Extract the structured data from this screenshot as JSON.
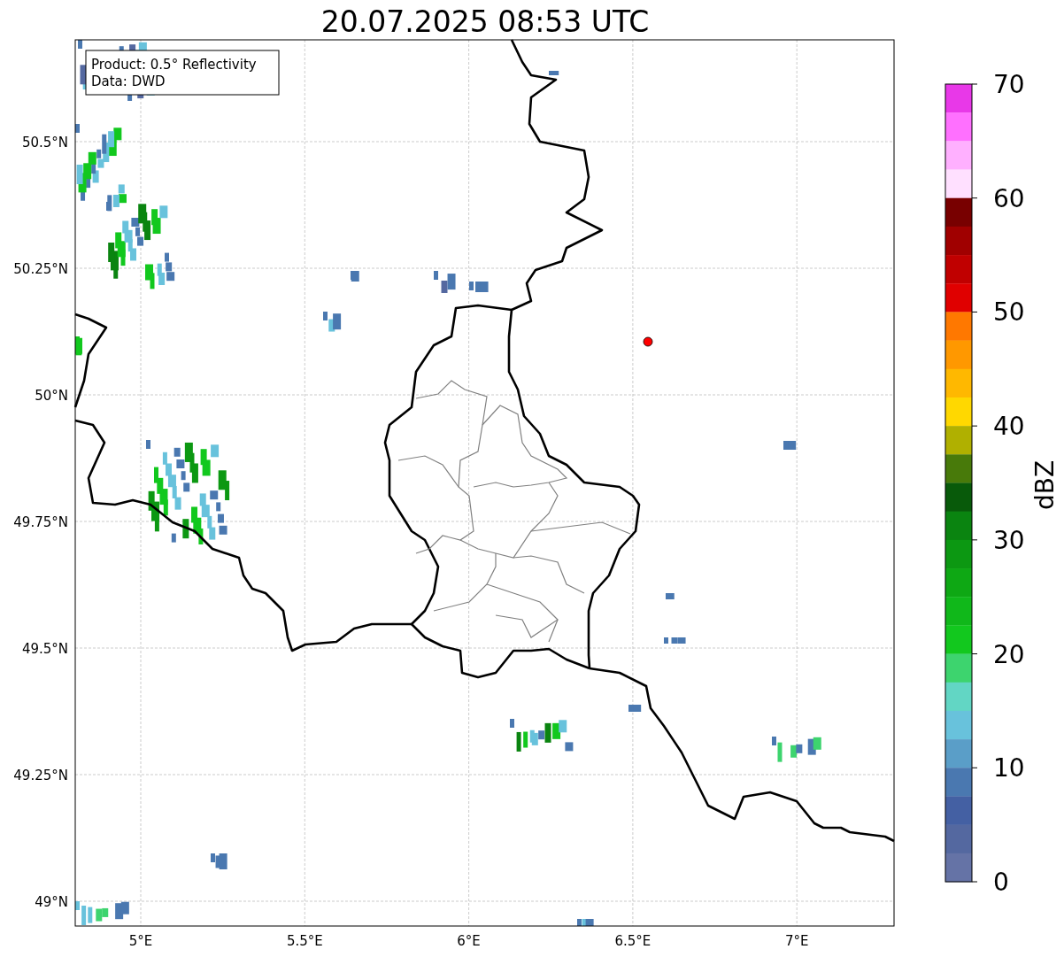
{
  "title": "20.07.2025 08:53 UTC",
  "info_box": [
    "Product: 0.5° Reflectivity",
    "Data: DWD"
  ],
  "lat_ticks": [
    "50.5°N",
    "50.25°N",
    "50°N",
    "49.75°N",
    "49.5°N",
    "49.25°N",
    "49°N"
  ],
  "lon_ticks": [
    "5°E",
    "5.5°E",
    "6°E",
    "6.5°E",
    "7°E"
  ],
  "colorbar": {
    "label": "dBZ",
    "ticks": [
      "70",
      "60",
      "50",
      "40",
      "30",
      "20",
      "10",
      "0"
    ],
    "bands": [
      {
        "color": "#e838e8"
      },
      {
        "color": "#ff70ff"
      },
      {
        "color": "#ffb0ff"
      },
      {
        "color": "#ffe0ff"
      },
      {
        "color": "#780000"
      },
      {
        "color": "#a00000"
      },
      {
        "color": "#c00000"
      },
      {
        "color": "#e00000"
      },
      {
        "color": "#ff7800"
      },
      {
        "color": "#ff9800"
      },
      {
        "color": "#ffb800"
      },
      {
        "color": "#ffd800"
      },
      {
        "color": "#b0b000"
      },
      {
        "color": "#487a0a"
      },
      {
        "color": "#085a0a"
      },
      {
        "color": "#0a8410"
      },
      {
        "color": "#0c9812"
      },
      {
        "color": "#0ea814"
      },
      {
        "color": "#10b81a"
      },
      {
        "color": "#12c81e"
      },
      {
        "color": "#3dd46e"
      },
      {
        "color": "#62d6c4"
      },
      {
        "color": "#68c2dc"
      },
      {
        "color": "#5a9ec8"
      },
      {
        "color": "#4a78b0"
      },
      {
        "color": "#4460a3"
      },
      {
        "color": "#5468a0"
      },
      {
        "color": "#6573a6"
      }
    ]
  }
}
